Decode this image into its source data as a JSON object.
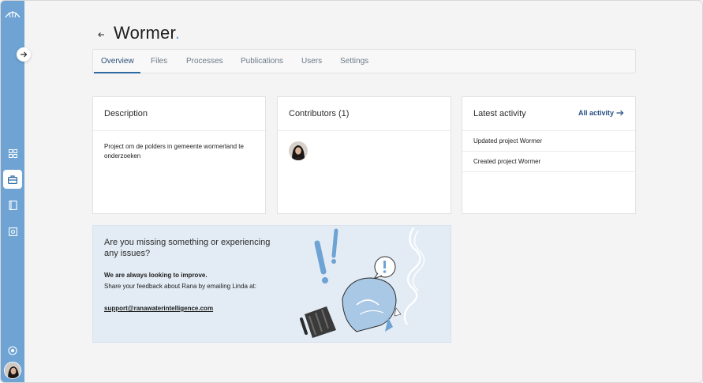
{
  "project": {
    "title": "Wormer",
    "title_dot": "."
  },
  "tabs": [
    {
      "label": "Overview"
    },
    {
      "label": "Files"
    },
    {
      "label": "Processes"
    },
    {
      "label": "Publications"
    },
    {
      "label": "Users"
    },
    {
      "label": "Settings"
    }
  ],
  "description": {
    "title": "Description",
    "text": "Project om de polders in gemeente wormerland te onderzoeken"
  },
  "contributors": {
    "title": "Contributors (1)"
  },
  "activity": {
    "title": "Latest activity",
    "link_label": "All activity",
    "items": [
      "Updated project Wormer",
      "Created project Wormer"
    ]
  },
  "feedback": {
    "title": "Are you missing something or experiencing any issues?",
    "strong": "We are always looking to improve.",
    "text": "Share your feedback about Rana by emailing Linda at:",
    "email": "support@ranawaterintelligence.com"
  },
  "icons": {
    "logo": "umbrella-logo-icon",
    "expand": "arrow-right-icon",
    "nav": [
      "grid-icon",
      "briefcase-icon",
      "book-icon",
      "settings-box-icon",
      "target-icon"
    ]
  },
  "colors": {
    "sidebar": "#6ea3d3",
    "accent": "#2d6aa3",
    "link": "#244e82",
    "feedback_bg": "#e3ecf5"
  }
}
